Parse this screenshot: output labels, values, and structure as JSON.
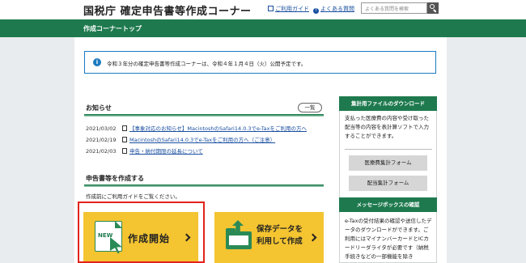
{
  "header": {
    "title": "国税庁 確定申告書等作成コーナー",
    "guide_link": "ご利用ガイド",
    "faq_link": "よくある質問",
    "search_placeholder": "よくある質問を検索"
  },
  "banner": {
    "title": "作成コーナートップ"
  },
  "notice": {
    "text": "令和３年分の確定申告書等作成コーナーは、令和４年１月４日（火）公開予定です。"
  },
  "news": {
    "heading": "お知らせ",
    "list_button": "一覧",
    "items": [
      {
        "date": "2021/03/02",
        "text": "【事象対応のお知らせ】MacintoshのSafari14.0.3でe-Taxをご利用の方へ"
      },
      {
        "date": "2021/02/19",
        "text": "MacintoshのSafari14.0.3でe-Taxをご利用の方へ（ご注意）"
      },
      {
        "date": "2021/02/03",
        "text": "申告・納付期限の延長について"
      }
    ]
  },
  "create": {
    "heading": "申告書等を作成する",
    "caption": "作成前にご利用ガイドをご覧ください。",
    "new_icon_label": "NEW",
    "start_button": "作成開始",
    "saved_button_line1": "保存データを",
    "saved_button_line2": "利用して作成"
  },
  "sidebar": {
    "download_heading": "集計用ファイルのダウンロード",
    "download_text": "支払った医療費の内容や受け取った配当等の内容を表計算ソフトで入力することができます。",
    "medical_button": "医療費集計フォーム",
    "dividend_button": "配当集計フォーム",
    "message_heading": "メッセージボックスの確認",
    "message_text": "e-Taxの受付結果の確認や送信したデータのダウンロードができます。ご利用にはマイナンバーカードとICカードリーダライタが必要です（納税手続きなどの一部機能を除き"
  },
  "colors": {
    "green": "#1e7a4e",
    "yellow": "#f4c431",
    "blue": "#1b7bc0",
    "highlight": "#e2231a"
  }
}
